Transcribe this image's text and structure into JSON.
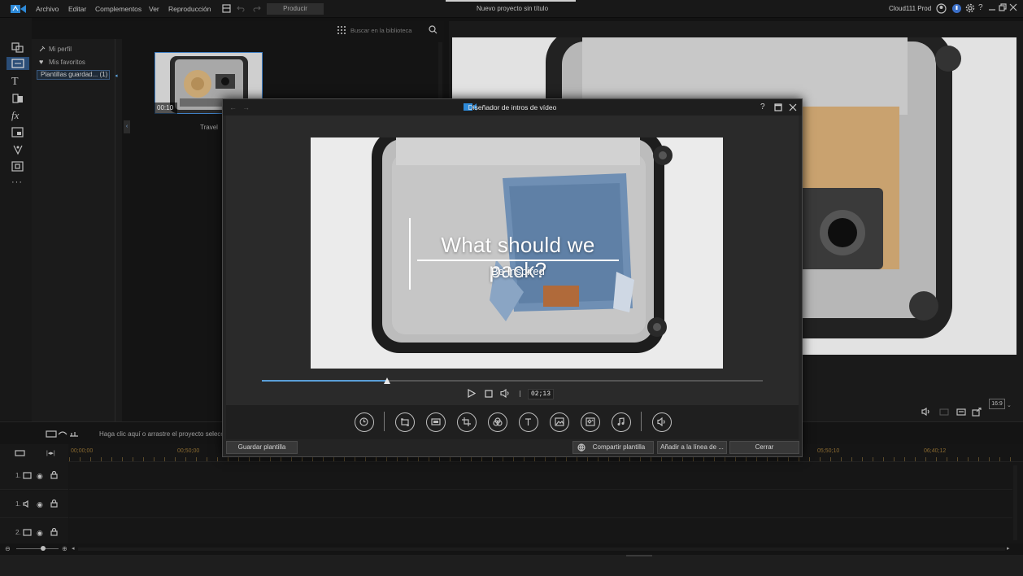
{
  "menubar": {
    "items": [
      "Archivo",
      "Editar",
      "Complementos",
      "Ver",
      "Reproducción"
    ],
    "produce": "Producir",
    "project_title": "Nuevo proyecto sin título",
    "user": "Cloud111 Prod"
  },
  "library": {
    "search_placeholder": "Buscar en la biblioteca",
    "tree": {
      "profile": "Mi perfil",
      "favorites": "Mis favoritos",
      "saved_templates": "Plantillas guardad... (1)"
    },
    "thumb": {
      "duration": "00:10",
      "label": "Travel"
    }
  },
  "timeline": {
    "hint": "Haga clic aquí o arrastre el proyecto selecc",
    "ruler": [
      "00;00;00",
      "00;50;00",
      "05;50;10",
      "06;40;12"
    ],
    "tracks": [
      "1.",
      "1.",
      "2."
    ]
  },
  "preview": {
    "aspect": "16:9"
  },
  "dialog": {
    "title": "Diseñador de intros de vídeo",
    "video_title": "What should we pack?",
    "video_subtitle": "Be Inspired",
    "progress": 0.25,
    "time": "02;13",
    "buttons": {
      "save_template": "Guardar plantilla",
      "share_template": "Compartir plantilla",
      "add_to_timeline": "Añadir a la línea de ...",
      "close": "Cerrar"
    }
  },
  "colors": {
    "accent": "#5a9fd8",
    "ruler_text": "#8a6a30",
    "bg": "#131313"
  }
}
